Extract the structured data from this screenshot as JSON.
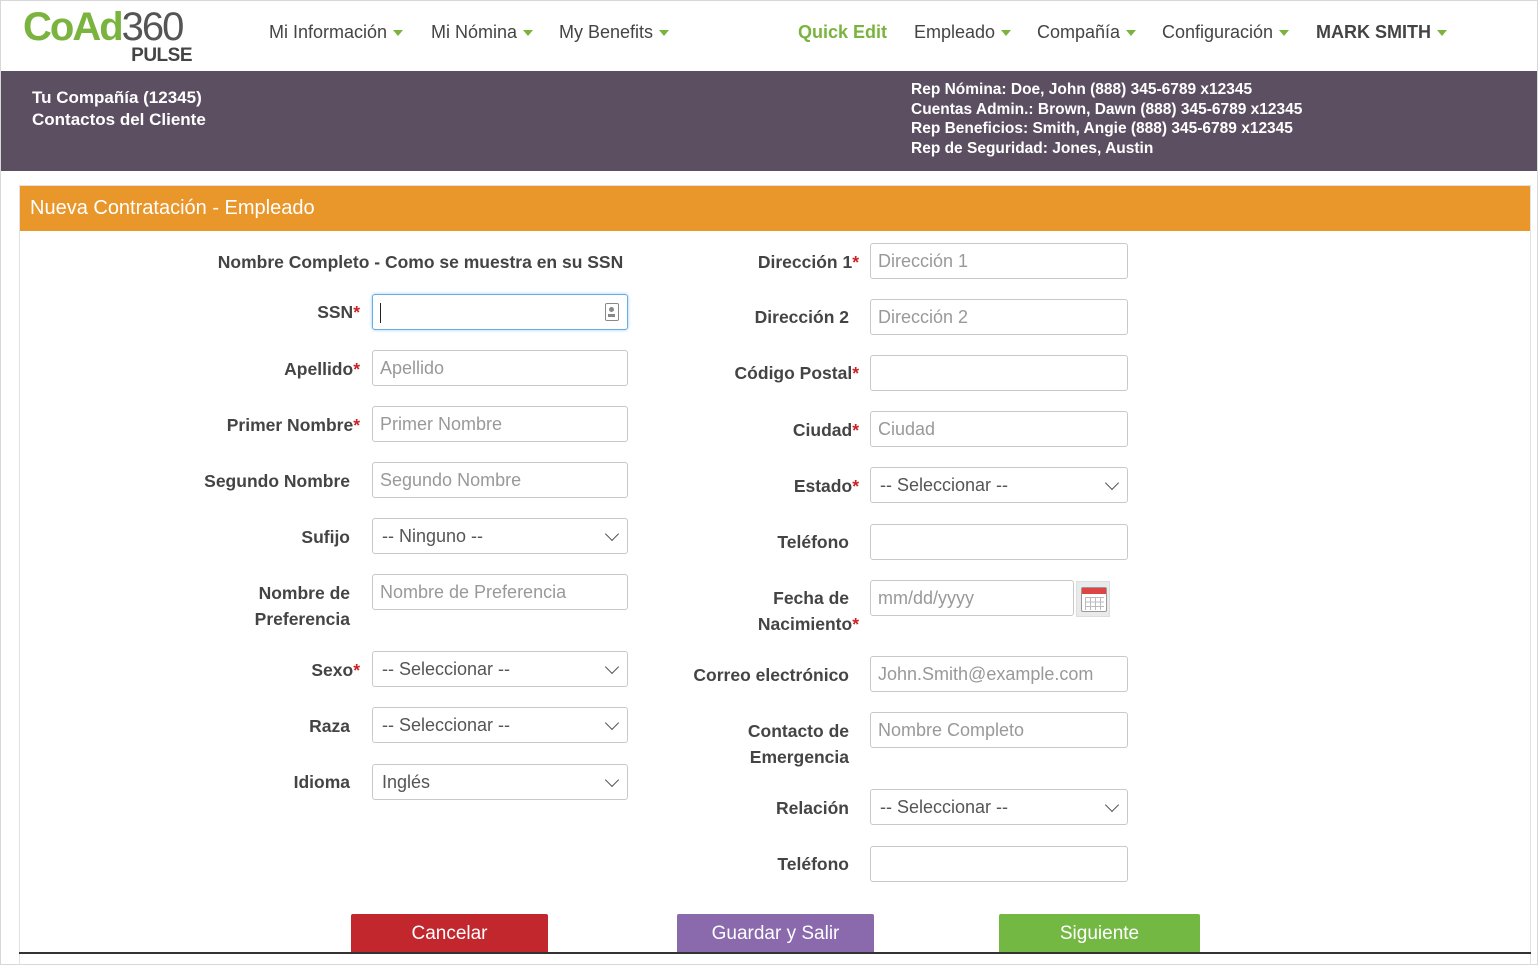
{
  "brand": {
    "logo_main_a": "CoAd",
    "logo_main_b": "360",
    "logo_sub": "PULSE",
    "accent": "#7ab33e"
  },
  "nav": {
    "mi_informacion": "Mi Información",
    "mi_nomina": "Mi Nómina",
    "my_benefits": "My Benefits",
    "quick_edit": "Quick Edit",
    "empleado": "Empleado",
    "compania": "Compañía",
    "configuracion": "Configuración",
    "user": "MARK SMITH"
  },
  "contacts": {
    "company": "Tu Compañía (12345)",
    "client_contacts": "Contactos del Cliente",
    "payroll_rep": "Rep Nómina: Doe, John (888) 345-6789 x12345",
    "admin_accounts": "Cuentas Admin.: Brown, Dawn (888) 345-6789 x12345",
    "benefits_rep": "Rep Beneficios: Smith, Angie (888) 345-6789 x12345",
    "safety_rep": "Rep de Seguridad: Jones, Austin",
    "band_color": "#5c4f62"
  },
  "panel": {
    "title": "Nueva Contratación - Empleado",
    "header_color": "#e9962a"
  },
  "left": {
    "full_name_heading": "Nombre Completo - Como se muestra en su SSN",
    "ssn_label": "SSN",
    "ssn_value": "",
    "last_name_label": "Apellido",
    "last_name_placeholder": "Apellido",
    "first_name_label": "Primer Nombre",
    "first_name_placeholder": "Primer Nombre",
    "middle_name_label": "Segundo Nombre",
    "middle_name_placeholder": "Segundo Nombre",
    "suffix_label": "Sufijo",
    "suffix_value": "-- Ninguno --",
    "preferred_label_1": "Nombre de",
    "preferred_label_2": "Preferencia",
    "preferred_placeholder": "Nombre de Preferencia",
    "sex_label": "Sexo",
    "sex_value": "-- Seleccionar --",
    "race_label": "Raza",
    "race_value": "-- Seleccionar --",
    "language_label": "Idioma",
    "language_value": "Inglés"
  },
  "right": {
    "address1_label": "Dirección 1",
    "address1_placeholder": "Dirección 1",
    "address2_label": "Dirección 2",
    "address2_placeholder": "Dirección 2",
    "zip_label": "Código Postal",
    "zip_value": "",
    "city_label": "Ciudad",
    "city_placeholder": "Ciudad",
    "state_label": "Estado",
    "state_value": "-- Seleccionar --",
    "phone_label": "Teléfono",
    "phone_value": "",
    "dob_label_1": "Fecha de",
    "dob_label_2": "Nacimiento",
    "dob_placeholder": "mm/dd/yyyy",
    "email_label": "Correo electrónico",
    "email_placeholder": "John.Smith@example.com",
    "emergency_label_1": "Contacto de",
    "emergency_label_2": "Emergencia",
    "emergency_placeholder": "Nombre Completo",
    "relation_label": "Relación",
    "relation_value": "-- Seleccionar --",
    "emergency_phone_label": "Teléfono",
    "emergency_phone_value": ""
  },
  "required_mark": "*",
  "buttons": {
    "cancel": "Cancelar",
    "save_exit": "Guardar y Salir",
    "next": "Siguiente",
    "cancel_color": "#c1272d",
    "save_color": "#8a69ad",
    "next_color": "#74b844"
  }
}
